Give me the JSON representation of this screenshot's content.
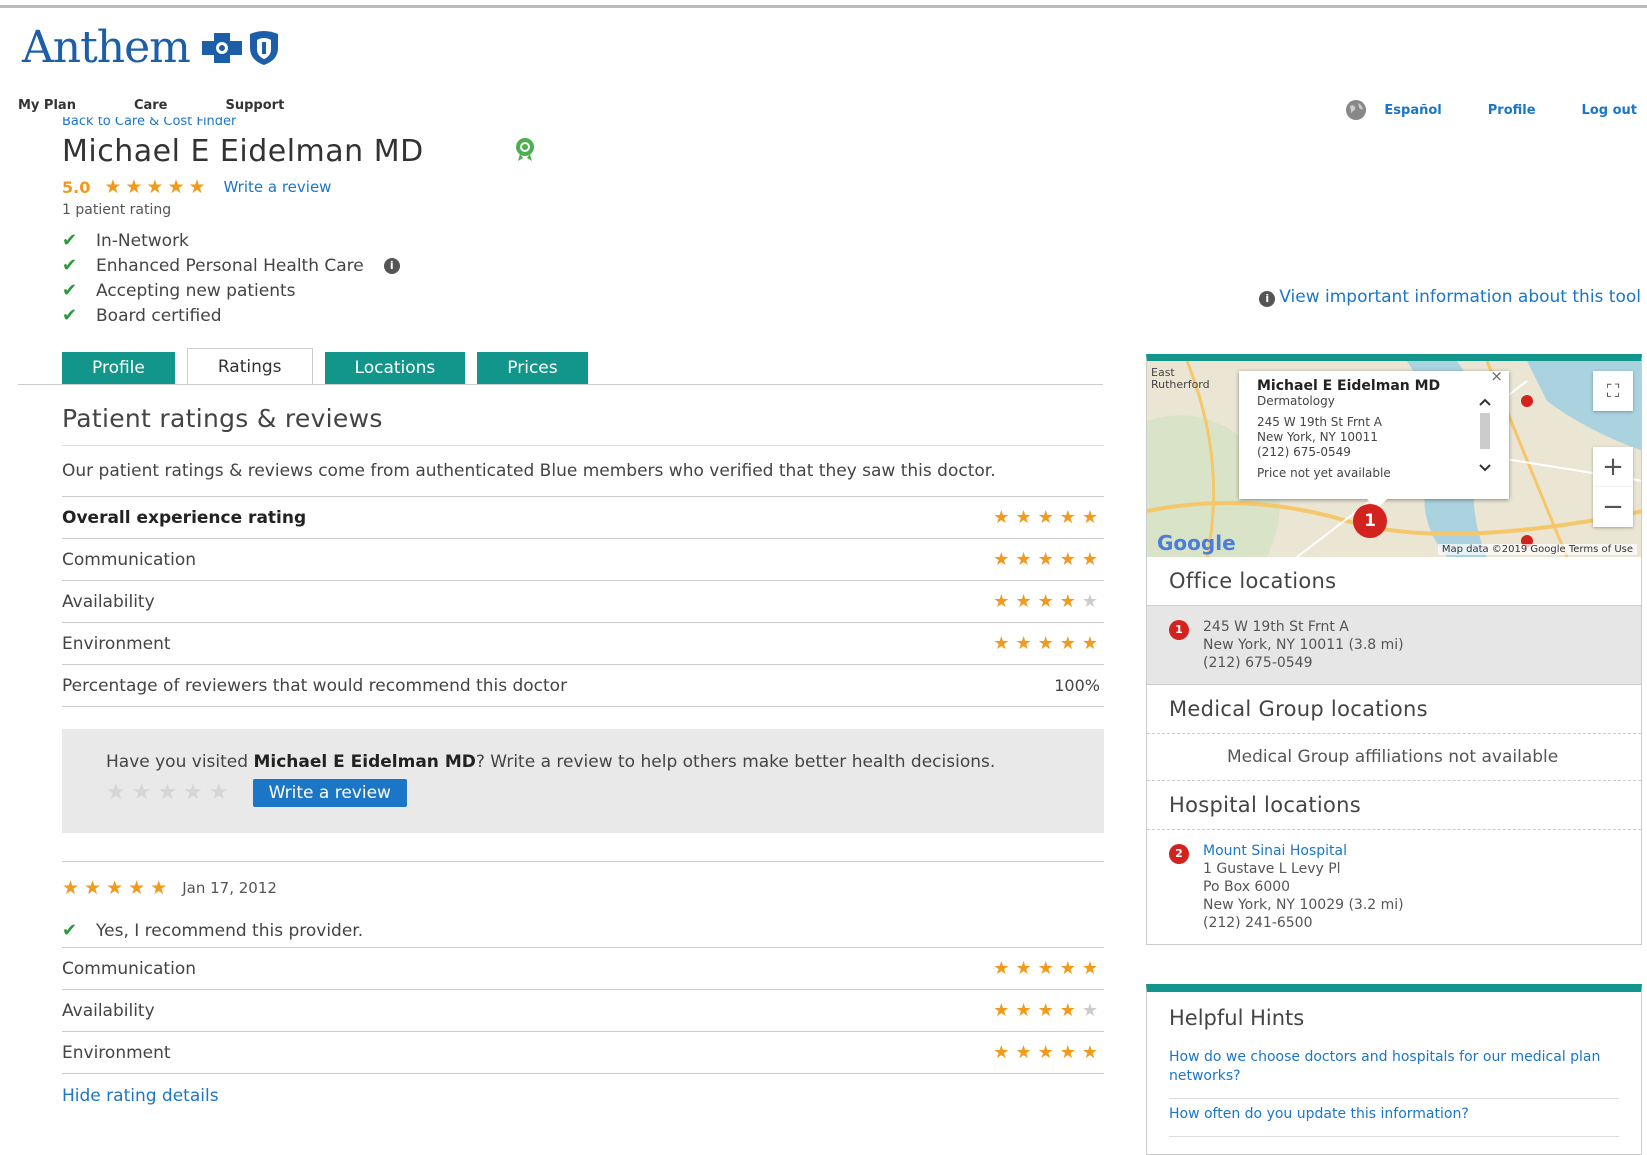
{
  "brand": {
    "name": "Anthem",
    "color": "#1c5fa8",
    "accent": "#12968c",
    "link": "#1c76c7",
    "star": "#f29a1c"
  },
  "nav": {
    "items": [
      "My Plan",
      "Care",
      "Support"
    ]
  },
  "util": {
    "language": "Español",
    "profile": "Profile",
    "logout": "Log out",
    "globe_icon": "globe-icon"
  },
  "back_link": "Back to Care & Cost Finder",
  "doctor": {
    "name": "Michael E Eidelman MD",
    "rating": "5.0",
    "stars": 5,
    "write_review": "Write a review",
    "patient_count": "1 patient rating",
    "features": [
      "In-Network",
      "Enhanced Personal Health Care",
      "Accepting new patients",
      "Board certified"
    ]
  },
  "view_info": "View important information about this tool",
  "tabs": [
    {
      "label": "Profile",
      "active": false
    },
    {
      "label": "Ratings",
      "active": true
    },
    {
      "label": "Locations",
      "active": false
    },
    {
      "label": "Prices",
      "active": false
    }
  ],
  "ratings": {
    "title": "Patient ratings & reviews",
    "intro": "Our patient ratings & reviews come from authenticated Blue members who verified that they saw this doctor.",
    "rows": [
      {
        "label": "Overall experience rating",
        "stars": 5
      },
      {
        "label": "Communication",
        "stars": 5
      },
      {
        "label": "Availability",
        "stars": 4
      },
      {
        "label": "Environment",
        "stars": 5
      }
    ],
    "recommend_label": "Percentage of reviewers that would recommend this doctor",
    "recommend_value": "100%",
    "box": {
      "prefix": "Have you visited ",
      "name": "Michael E Eidelman MD",
      "suffix": "? Write a review to help others make better health decisions.",
      "button": "Write a review"
    },
    "review": {
      "stars": 5,
      "date": "Jan 17, 2012",
      "recommend": "Yes, I recommend this provider.",
      "rows": [
        {
          "label": "Communication",
          "stars": 5
        },
        {
          "label": "Availability",
          "stars": 4
        },
        {
          "label": "Environment",
          "stars": 5
        }
      ],
      "hide": "Hide rating details"
    }
  },
  "map": {
    "popup": {
      "name": "Michael E Eidelman MD",
      "specialty": "Dermatology",
      "address1": "245 W 19th St Frnt A",
      "address2": "New York, NY 10011",
      "phone": "(212) 675-0549",
      "price": "Price not yet available"
    },
    "marker": "1",
    "google": "Google",
    "footer": "Map data ©2019 Google   Terms of Use",
    "labels": [
      "East Rutherford"
    ]
  },
  "office": {
    "title": "Office locations",
    "pin": "1",
    "line1": "245 W 19th St Frnt A",
    "line2": "New York, NY 10011 (3.8 mi)",
    "line3": "(212) 675-0549"
  },
  "medical_group": {
    "title": "Medical Group locations",
    "note": "Medical Group affiliations not available"
  },
  "hospital": {
    "title": "Hospital locations",
    "pin": "2",
    "name": "Mount Sinai Hospital",
    "line1": "1 Gustave L Levy Pl",
    "line2": "Po Box 6000",
    "line3": "New York, NY 10029 (3.2 mi)",
    "line4": "(212) 241-6500"
  },
  "hints": {
    "title": "Helpful Hints",
    "items": [
      "How do we choose doctors and hospitals for our medical plan networks?",
      "How often do you update this information?"
    ]
  }
}
